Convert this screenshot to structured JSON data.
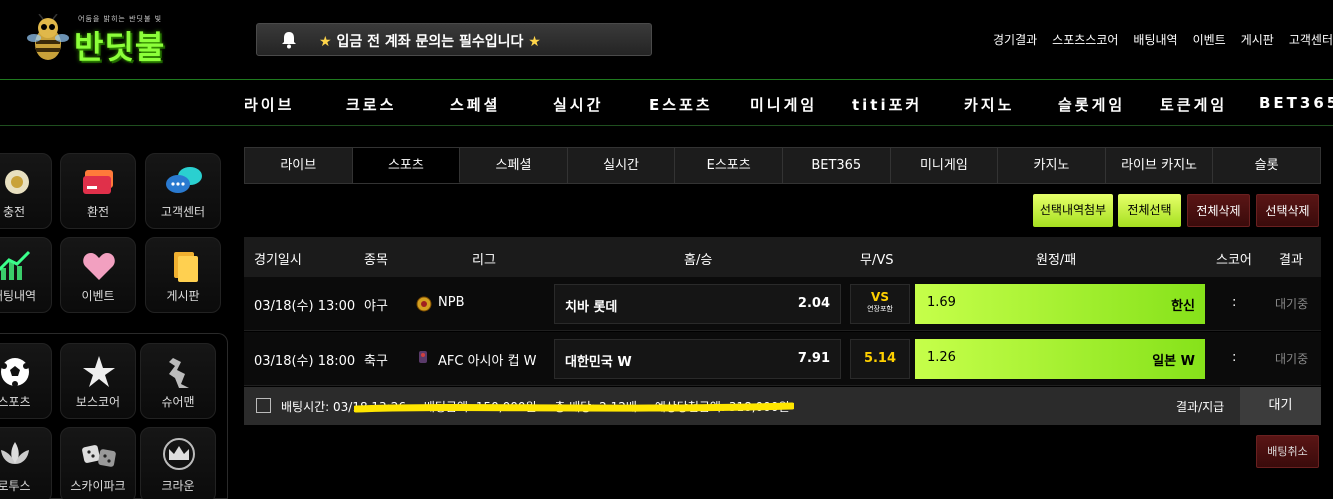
{
  "logo": {
    "text": "반딧불",
    "tagline": "어둠을 밝히는 반딧불 빛"
  },
  "notice": {
    "text": "입금 전 계좌 문의는 필수입니다",
    "star": "★"
  },
  "topnav": [
    "경기결과",
    "스포츠스코어",
    "배팅내역",
    "이벤트",
    "게시판",
    "고객센터"
  ],
  "mainnav": [
    "라이브",
    "크로스",
    "스페셜",
    "실시간",
    "E스포츠",
    "미니게임",
    "titi포커",
    "카지노",
    "슬롯게임",
    "토큰게임",
    "BET365"
  ],
  "sidebar": {
    "tiles": [
      {
        "label": "충전",
        "icon": "charge-icon"
      },
      {
        "label": "환전",
        "icon": "exchange-card-icon"
      },
      {
        "label": "고객센터",
        "icon": "chat-bubble-icon"
      },
      {
        "label": "배팅내역",
        "icon": "chart-icon"
      },
      {
        "label": "이벤트",
        "icon": "heart-icon"
      },
      {
        "label": "게시판",
        "icon": "board-icon"
      },
      {
        "label": "스포츠",
        "icon": "soccer-ball-icon"
      },
      {
        "label": "보스코어",
        "icon": "star-icon"
      },
      {
        "label": "슈어맨",
        "icon": "sureman-icon"
      },
      {
        "label": "로투스",
        "icon": "lotus-icon"
      },
      {
        "label": "스카이파크",
        "icon": "dice-icon"
      },
      {
        "label": "크라운",
        "icon": "crown-icon"
      }
    ]
  },
  "tabs": [
    {
      "label": "라이브",
      "active": false
    },
    {
      "label": "스포츠",
      "active": true
    },
    {
      "label": "스페셜",
      "active": false
    },
    {
      "label": "실시간",
      "active": false
    },
    {
      "label": "E스포츠",
      "active": false
    },
    {
      "label": "BET365",
      "active": false
    },
    {
      "label": "미니게임",
      "active": false
    },
    {
      "label": "카지노",
      "active": false
    },
    {
      "label": "라이브 카지노",
      "active": false
    },
    {
      "label": "슬롯",
      "active": false
    }
  ],
  "actions": {
    "attach": "선택내역첨부",
    "select_all": "전체선택",
    "delete_all": "전체삭제",
    "delete_selected": "선택삭제"
  },
  "table": {
    "headers": {
      "date": "경기일시",
      "sport": "종목",
      "league": "리그",
      "home": "홈/승",
      "draw": "무/VS",
      "away": "원정/패",
      "score": "스코어",
      "result": "결과"
    },
    "rows": [
      {
        "date": "03/18(수) 13:00",
        "sport": "야구",
        "league": "NPB",
        "home": "치바 롯데",
        "home_odds": "2.04",
        "draw": "VS",
        "draw_sub": "연장포함",
        "away_odds": "1.69",
        "away": "한신",
        "score": ":",
        "result": "대기중"
      },
      {
        "date": "03/18(수) 18:00",
        "sport": "축구",
        "league": "AFC 아시아 컵 W",
        "home": "대한민국 W",
        "home_odds": "7.91",
        "draw": "5.14",
        "draw_sub": "",
        "away_odds": "1.26",
        "away": "일본 W",
        "score": ":",
        "result": "대기중"
      }
    ]
  },
  "summary": {
    "bet_time": "배팅시간: 03/18 13:26",
    "bet_amount": "배팅금액: 150,000원",
    "total_odds": "총 배당: 2.12배",
    "expected": "예상당첨금액: 318,000원",
    "result_label": "결과/지급",
    "status": "대기"
  },
  "cancel_button": "배팅취소",
  "colors": {
    "brand_green": "#8cff3a",
    "odds_lime": "#c6ff4a",
    "highlight_yellow": "#ffe600",
    "delete_red": "#5a1515"
  }
}
